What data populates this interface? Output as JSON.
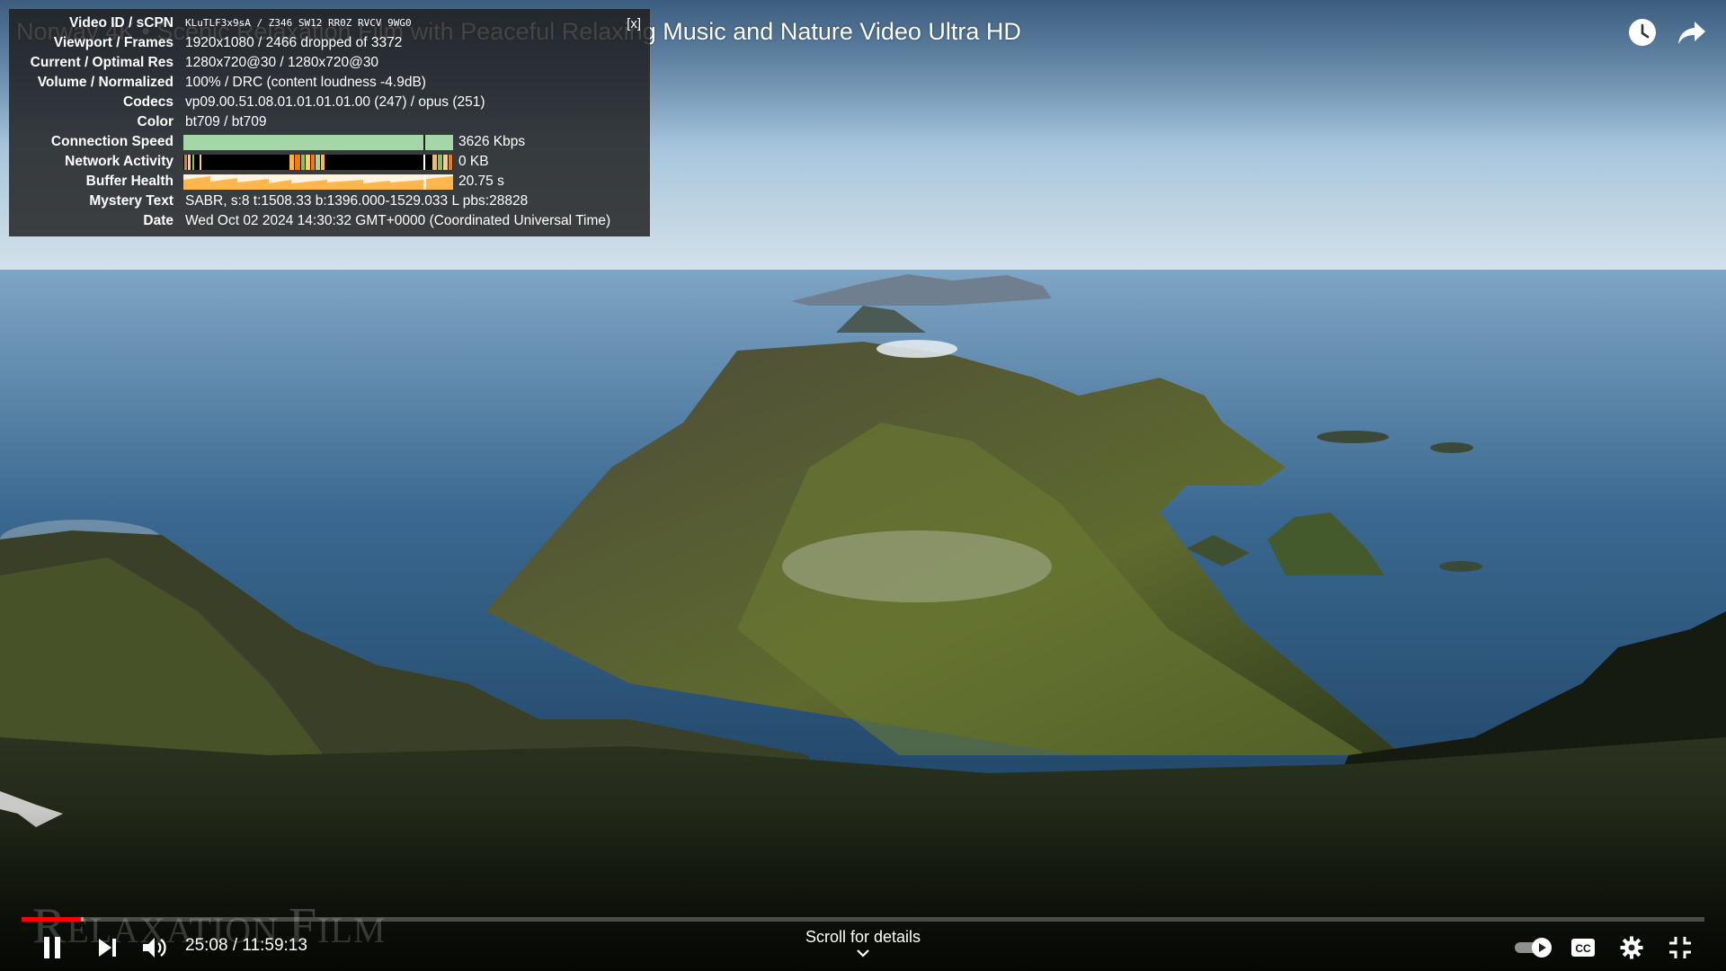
{
  "video": {
    "title": "Norway 4K • Scenic Relaxation Film with Peaceful Relaxing Music and Nature Video Ultra HD",
    "watermark_big": "R",
    "watermark_text": "ELAXATION ",
    "watermark_big2": "F",
    "watermark_text2": "ILM"
  },
  "top_controls": {
    "watch_later_icon": "clock-icon",
    "share_icon": "share-arrow-icon"
  },
  "stats": {
    "close_label": "[x]",
    "rows": [
      {
        "label": "Video ID / sCPN",
        "value": "KLuTLF3x9sA / Z346 SW12 RR0Z RVCV 9WG0"
      },
      {
        "label": "Viewport / Frames",
        "value": "1920x1080 / 2466 dropped of 3372"
      },
      {
        "label": "Current / Optimal Res",
        "value": "1280x720@30 / 1280x720@30"
      },
      {
        "label": "Volume / Normalized",
        "value": "100% / DRC (content loudness -4.9dB)"
      },
      {
        "label": "Codecs",
        "value": "vp09.00.51.08.01.01.01.01.00 (247) / opus (251)"
      },
      {
        "label": "Color",
        "value": "bt709 / bt709"
      },
      {
        "label": "Connection Speed",
        "value": "3626 Kbps"
      },
      {
        "label": "Network Activity",
        "value": "0 KB"
      },
      {
        "label": "Buffer Health",
        "value": "20.75 s"
      },
      {
        "label": "Mystery Text",
        "value": "SABR, s:8 t:1508.33 b:1396.000-1529.033 L pbs:28828"
      },
      {
        "label": "Date",
        "value": "Wed Oct 02 2024 14:30:32 GMT+0000 (Coordinated Universal Time)"
      }
    ],
    "graph_colors": {
      "connection": "#a5d6a7",
      "network_bar": "#f57c00",
      "network_green": "#8bc34a",
      "buffer": "#ffb74d"
    }
  },
  "playback": {
    "current_time": "25:08",
    "separator": " / ",
    "duration": "11:59:13",
    "played_fraction": 0.035,
    "loaded_fraction": 0.037,
    "scroll_hint": "Scroll for details",
    "accent": "#ff0000"
  },
  "controls": {
    "play_pause_icon": "pause-icon",
    "next_icon": "next-track-icon",
    "volume_icon": "volume-icon",
    "autoplay_icon": "autoplay-toggle-icon",
    "cc_icon": "closed-captions-icon",
    "settings_icon": "gear-icon",
    "exit_fullscreen_icon": "exit-fullscreen-icon"
  }
}
